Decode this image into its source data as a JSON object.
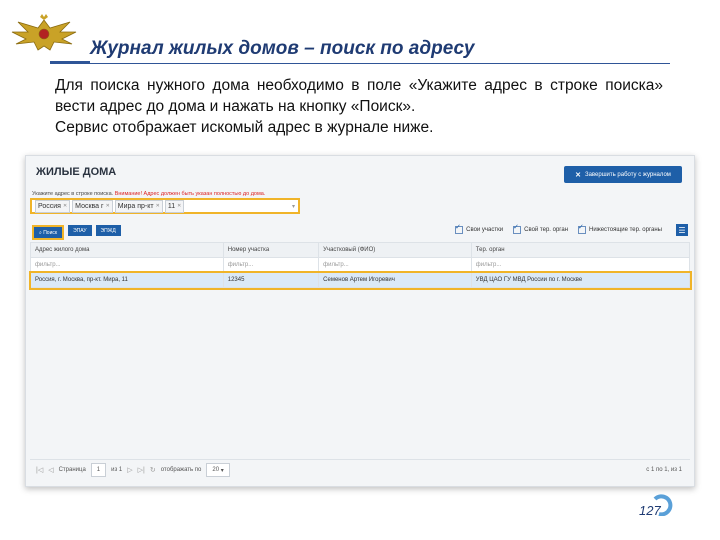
{
  "slide": {
    "title": "Журнал жилых домов – поиск по адресу",
    "description_lines": [
      "Для поиска нужного дома необходимо в поле «Укажите адрес в строке поиска» вести адрес до дома и нажать на кнопку «Поиск».",
      "Сервис отображает искомый адрес в журнале ниже."
    ],
    "page_number": "127",
    "emblem_icon": "double-headed-eagle-icon"
  },
  "app": {
    "header": "ЖИЛЫЕ ДОМА",
    "finish_button": "Завершить работу с журналом",
    "hint": "Укажите адрес в строке поиска.",
    "hint_warning": "Внимание! Адрес должен быть указан полностью до дома.",
    "search_chips": [
      "Россия",
      "Москва г",
      "Мира пр-кт",
      "11"
    ],
    "toolbar": {
      "search": "Поиск",
      "button2": "ЭПАУ",
      "button3": "ЭПЖД"
    },
    "filters": {
      "own_areas": "Свои участки",
      "own_ter": "Свой тер. орган",
      "lower_ter": "Нижестоящие тер. органы"
    },
    "columns": [
      "Адрес жилого дома",
      "Номер участка",
      "Участковый (ФИО)",
      "Тер. орган"
    ],
    "filter_placeholder": "фильтр...",
    "rows": [
      [
        "Россия, г. Москва, пр-кт. Мира, 11",
        "12345",
        "Семенов Артем Игоревич",
        "УВД ЦАО ГУ МВД России по г. Москве"
      ]
    ],
    "pager": {
      "page_label": "Страница",
      "page": "1",
      "of": "из 1",
      "show_label": "отображать по",
      "per_page": "20",
      "count": "с 1 по 1, из 1"
    }
  },
  "colors": {
    "accent": "#1e5fa8",
    "highlight": "#f0b429",
    "title": "#1f3b73"
  }
}
